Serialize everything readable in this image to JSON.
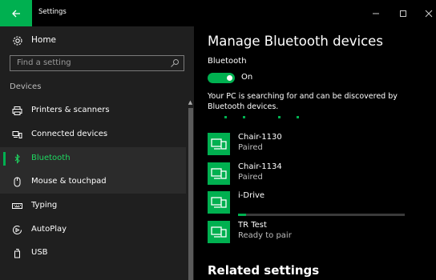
{
  "window": {
    "title": "Settings",
    "back_icon": "back-arrow-icon",
    "min_glyph": "–",
    "max_glyph": "☐",
    "close_glyph": "✕"
  },
  "sidebar": {
    "home_label": "Home",
    "search_placeholder": "Find a setting",
    "group_header": "Devices",
    "items": [
      {
        "label": "Printers & scanners",
        "icon": "printer-icon"
      },
      {
        "label": "Connected devices",
        "icon": "connected-devices-icon"
      },
      {
        "label": "Bluetooth",
        "icon": "bluetooth-icon",
        "selected": true
      },
      {
        "label": "Mouse & touchpad",
        "icon": "mouse-icon"
      },
      {
        "label": "Typing",
        "icon": "keyboard-icon"
      },
      {
        "label": "AutoPlay",
        "icon": "autoplay-icon"
      },
      {
        "label": "USB",
        "icon": "usb-icon"
      }
    ]
  },
  "main": {
    "title": "Manage Bluetooth devices",
    "bluetooth_label": "Bluetooth",
    "toggle_state": "On",
    "searching_text": "Your PC is searching for and can be discovered by Bluetooth devices.",
    "devices": [
      {
        "name": "Chair-1130",
        "status": "Paired",
        "icon": "device-pair-icon"
      },
      {
        "name": "Chair-1134",
        "status": "Paired",
        "icon": "device-pair-icon"
      },
      {
        "name": "i-Drive",
        "status": "",
        "icon": "device-pair-icon",
        "progress": 0.05
      },
      {
        "name": "TR Test",
        "status": "Ready to pair",
        "icon": "device-pair-icon"
      }
    ],
    "related_heading": "Related settings"
  },
  "colors": {
    "accent": "#00b050",
    "sidebar_bg": "#1f1f1f",
    "main_bg": "#000000"
  }
}
